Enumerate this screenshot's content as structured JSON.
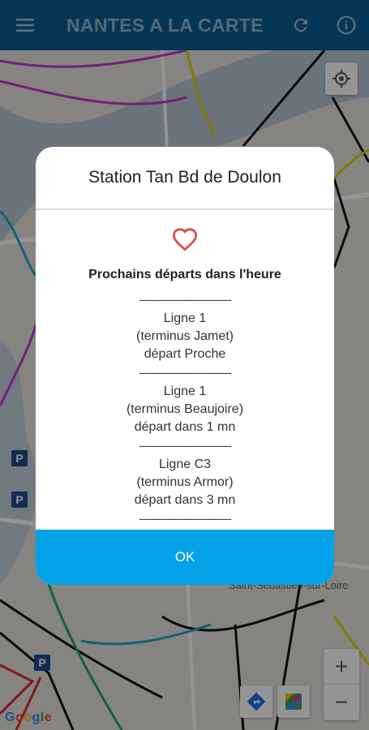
{
  "app": {
    "title": "NANTES A LA CARTE",
    "menu_icon": "menu-icon",
    "refresh_icon": "refresh-icon",
    "info_icon": "info-icon"
  },
  "map": {
    "label_place": "Saint-Sébastien-sur-Loire",
    "google": "Google",
    "zoom_in": "+",
    "zoom_out": "−",
    "parking": "P"
  },
  "dialog": {
    "title": "Station Tan Bd de Doulon",
    "favorite_icon": "heart-icon",
    "subtitle": "Prochains départs dans l'heure",
    "separator": "-------------------------------",
    "departures": [
      {
        "line": "Ligne 1",
        "terminus": "(terminus Jamet)",
        "departure": "départ Proche"
      },
      {
        "line": "Ligne 1",
        "terminus": "(terminus Beaujoire)",
        "departure": "départ dans 1 mn"
      },
      {
        "line": "Ligne C3",
        "terminus": "(terminus Armor)",
        "departure": "départ dans 3 mn"
      }
    ],
    "ok_label": "OK"
  },
  "colors": {
    "appbar": "#0a5e93",
    "title_text": "#8fb8d3",
    "ok_button": "#03a1e8",
    "heart": "#e0483b"
  }
}
